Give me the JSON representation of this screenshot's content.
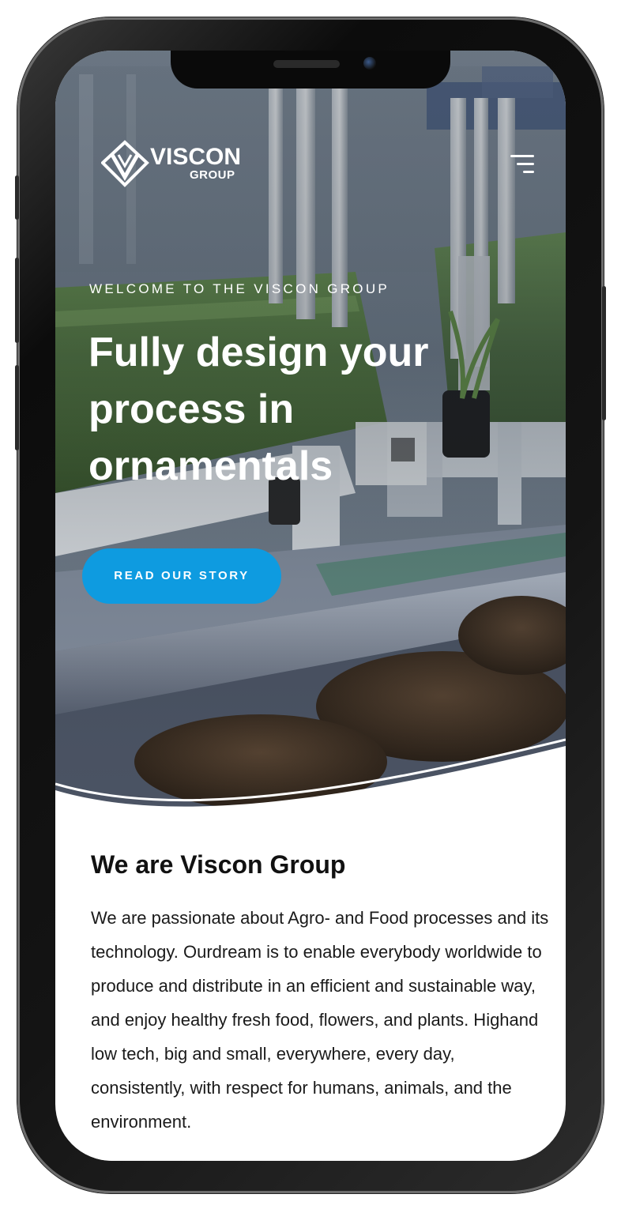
{
  "brand": {
    "name": "VISCON",
    "sub": "GROUP",
    "logo_icon": "viscon-v-logo-icon"
  },
  "header": {
    "menu_icon": "hamburger-menu-icon"
  },
  "hero": {
    "eyebrow": "WELCOME TO THE VISCON GROUP",
    "headline": "Fully design your process in ornamentals",
    "cta_label": "READ OUR STORY",
    "cta_color": "#0e9be0"
  },
  "about": {
    "title": "We are Viscon Group",
    "body": "We are passionate about Agro- and Food processes and its technology. Ourdream is to enable everybody worldwide to produce and distribute in an efficient and sustainable way, and enjoy healthy fresh food, flowers, and plants. Highand low tech, big and small, everywhere, every day, consistently, with respect for humans, animals, and the environment."
  }
}
